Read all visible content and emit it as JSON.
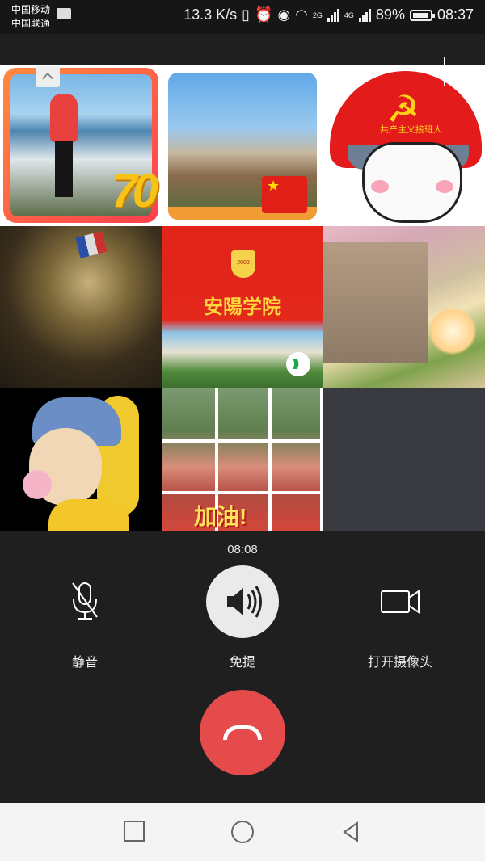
{
  "status_bar": {
    "carrier_1": "中国移动",
    "carrier_2": "中国联通",
    "network_speed": "13.3 K/s",
    "sim2_label": "2G",
    "sim1_label": "4G",
    "battery": "89%",
    "time": "08:37"
  },
  "grid": {
    "tile_1_overlay": "70",
    "tile_3_overlay": "共产主义接班人",
    "tile_5_title": "安陽学院",
    "tile_5_crest": "2003",
    "tile_8_overlay": "加油!"
  },
  "call": {
    "duration": "08:08",
    "mute_label": "静音",
    "speaker_label": "免提",
    "camera_label": "打开摄像头"
  },
  "colors": {
    "background": "#1f1f1f",
    "hangup": "#e54b4b",
    "speaker_active": "#eaeaea",
    "empty_tile": "#393a3f"
  }
}
